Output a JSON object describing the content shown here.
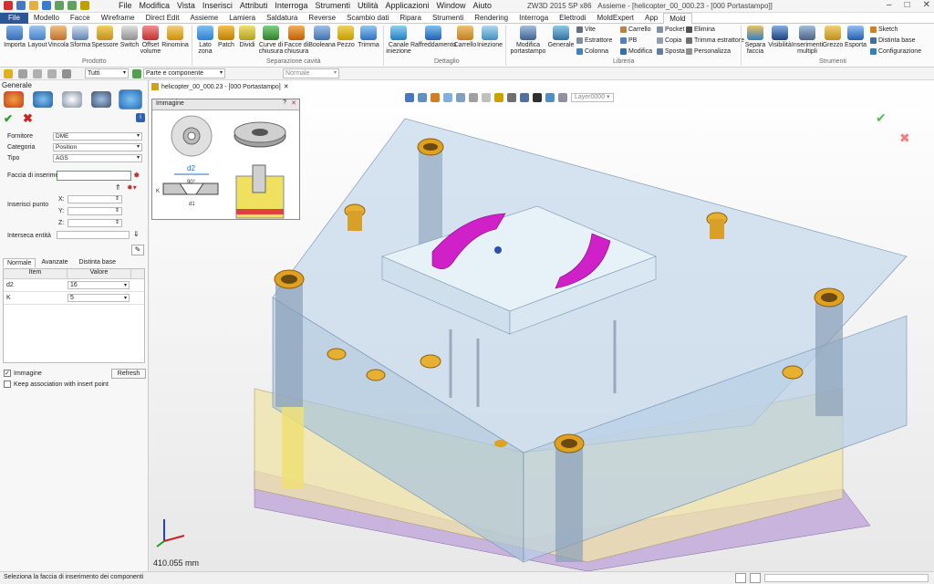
{
  "app": {
    "window_title": "ZW3D 2015 SP x86",
    "document_title": "Assieme - [helicopter_00_000.23 - [000 Portastampo]]"
  },
  "menu": [
    "File",
    "Modifica",
    "Vista",
    "Inserisci",
    "Attributi",
    "Interroga",
    "Strumenti",
    "Utilità",
    "Applicazioni",
    "Window",
    "Aiuto"
  ],
  "tabs": [
    "File",
    "Modello",
    "Facce",
    "Wireframe",
    "Direct Edit",
    "Assieme",
    "Lamiera",
    "Saldatura",
    "Reverse",
    "Scambio dati",
    "Ripara",
    "Strumenti",
    "Rendering",
    "Interroga",
    "Elettrodi",
    "MoldExpert",
    "App",
    "Mold"
  ],
  "ribbon": {
    "prodotto": {
      "label": "Prodotto",
      "buttons": [
        "Importa",
        "Layout",
        "Vincola",
        "Sforma",
        "Spessore",
        "Switch",
        "Offset volume",
        "Rinomina"
      ]
    },
    "separazione": {
      "label": "Separazione cavità",
      "buttons": [
        "Lato zona",
        "Patch",
        "Dividi",
        "Curve di chiusura",
        "Facce di chiusura",
        "Booleana",
        "Pezzo",
        "Trimma"
      ]
    },
    "dettaglio": {
      "label": "Dettaglio",
      "buttons": [
        "Canale iniezione",
        "Raffreddamento",
        "Carrello",
        "Iniezione"
      ]
    },
    "libreria": {
      "label": "Libreria",
      "buttons": [
        "Modifica portastampo",
        "Generale"
      ],
      "small": [
        "Vite",
        "Estrattore",
        "Colonna",
        "Carrello",
        "PB",
        "Modifica",
        "Pocket",
        "Copia",
        "Sposta",
        "Elimina",
        "Trimma estrattore",
        "Personalizza"
      ]
    },
    "strumenti": {
      "label": "Strumenti",
      "buttons": [
        "Separa faccia",
        "Visibilità",
        "Inserimenti multipli",
        "Grezzo",
        "Esporta"
      ],
      "small": [
        "Sketch",
        "Distinta base",
        "Configurazione"
      ]
    }
  },
  "toolbar": {
    "filter": "Tutti",
    "component": "Parte e componente",
    "mode": "Normale"
  },
  "doc_tab": "helicopter_00_000.23 - [000 Portastampo]",
  "layer": "Layer0000",
  "panel": {
    "title": "Generale",
    "fornitore_label": "Fornitore",
    "fornitore": "DME",
    "categoria_label": "Categoria",
    "categoria": "Position",
    "tipo_label": "Tipo",
    "tipo": "AGS",
    "faccia_label": "Faccia di inserimento",
    "inserisci_label": "Inserisci punto",
    "x_label": "X:",
    "y_label": "Y:",
    "z_label": "Z:",
    "interseca_label": "Interseca entità",
    "subtabs": [
      "Normale",
      "Avanzate",
      "Distinta base"
    ],
    "col_item": "Item",
    "col_valore": "Valore",
    "rows": [
      {
        "item": "d2",
        "valore": "16"
      },
      {
        "item": "K",
        "valore": "5"
      }
    ],
    "immagine_label": "Immagine",
    "refresh": "Refresh",
    "keep_label": "Keep association with insert point"
  },
  "image_popup": {
    "title": "Immagine",
    "d2": "d2",
    "angle": "90°",
    "k": "K",
    "d1": "d1"
  },
  "status": "Seleziona la faccia di inserimento dei componenti",
  "scale": "410.055 mm",
  "colors": {
    "accent": "#2b5797",
    "mold_blue": "#a9c4dd",
    "magenta": "#d020c8",
    "gold": "#e0a020",
    "yellow": "#f3e6a0",
    "purple": "#c8b0dc"
  }
}
